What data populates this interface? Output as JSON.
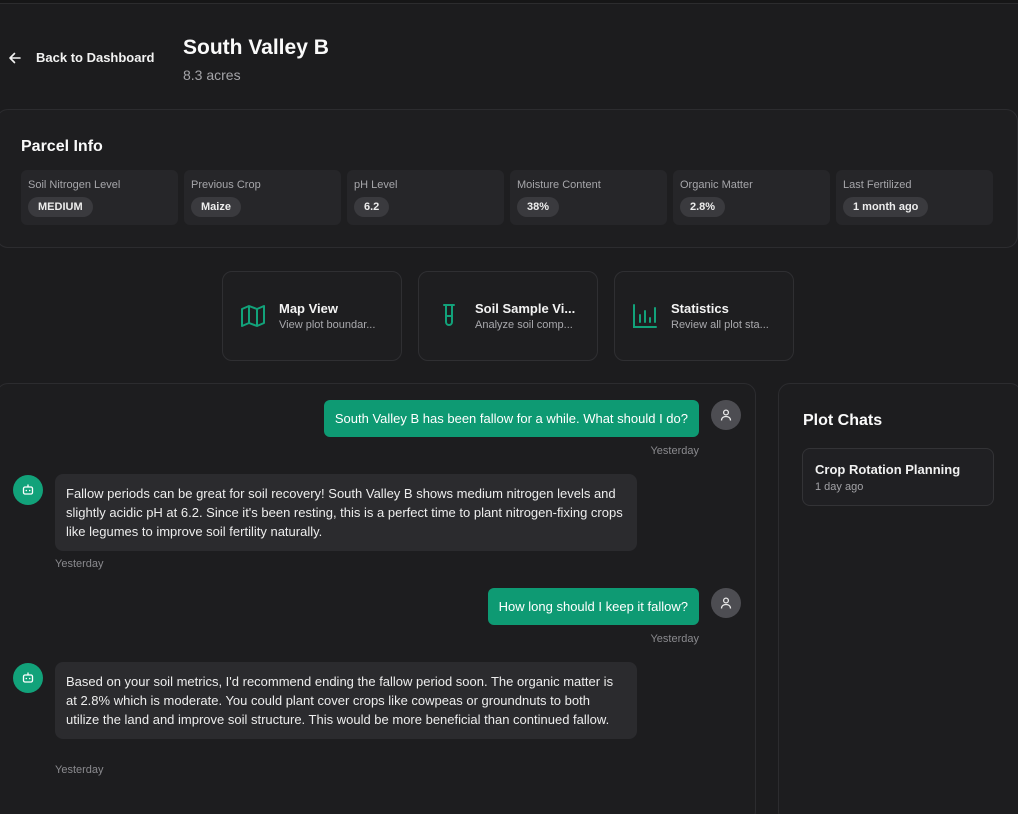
{
  "header": {
    "back_label": "Back to Dashboard",
    "title": "South Valley B",
    "subtitle": "8.3 acres"
  },
  "parcel_info": {
    "title": "Parcel Info",
    "metrics": [
      {
        "label": "Soil Nitrogen Level",
        "value": "MEDIUM"
      },
      {
        "label": "Previous Crop",
        "value": "Maize"
      },
      {
        "label": "pH Level",
        "value": "6.2"
      },
      {
        "label": "Moisture Content",
        "value": "38%"
      },
      {
        "label": "Organic Matter",
        "value": "2.8%"
      },
      {
        "label": "Last Fertilized",
        "value": "1 month ago"
      }
    ]
  },
  "actions": [
    {
      "title": "Map View",
      "desc": "View plot boundar...",
      "icon": "map-icon"
    },
    {
      "title": "Soil Sample Vi...",
      "desc": "Analyze soil comp...",
      "icon": "test-tube-icon"
    },
    {
      "title": "Statistics",
      "desc": "Review all plot sta...",
      "icon": "bar-chart-icon"
    }
  ],
  "chat": {
    "messages": [
      {
        "role": "user",
        "text": "South Valley B has been fallow for a while. What should I do?",
        "time": "Yesterday"
      },
      {
        "role": "assistant",
        "text": "Fallow periods can be great for soil recovery! South Valley B shows medium nitrogen levels and slightly acidic pH at 6.2. Since it's been resting, this is a perfect time to plant nitrogen-fixing crops like legumes to improve soil fertility naturally.",
        "time": "Yesterday"
      },
      {
        "role": "user",
        "text": "How long should I keep it fallow?",
        "time": "Yesterday"
      },
      {
        "role": "assistant",
        "text": "Based on your soil metrics, I'd recommend ending the fallow period soon. The organic matter is at 2.8% which is moderate. You could plant cover crops like cowpeas or groundnuts to both utilize the land and improve soil structure. This would be more beneficial than continued fallow.",
        "time": "Yesterday"
      }
    ]
  },
  "plot_chats": {
    "title": "Plot Chats",
    "items": [
      {
        "title": "Crop Rotation Planning",
        "time": "1 day ago"
      }
    ]
  },
  "colors": {
    "accent": "#0e9a73",
    "background": "#1c1c1e",
    "card": "#1e1e20",
    "badge": "#3a3a3e"
  }
}
